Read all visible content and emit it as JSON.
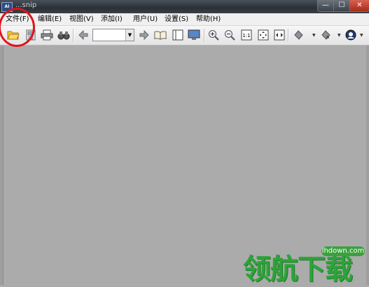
{
  "window": {
    "title": "...snip",
    "app_icon_text": "AI",
    "minimize": "—",
    "maximize": "☐",
    "close": "✕"
  },
  "menu": {
    "items": [
      "文件(F)",
      "编辑(E)",
      "视图(V)",
      "添加(I)",
      "用户(U)",
      "设置(S)",
      "帮助(H)"
    ]
  },
  "toolbar": {
    "buttons": [
      "open-folder-icon",
      "save-icon",
      "print-icon",
      "find-icon",
      "back-arrow-icon",
      "forward-arrow-icon",
      "open-book-icon",
      "single-page-icon",
      "monitor-icon",
      "zoom-in-icon",
      "zoom-out-icon",
      "actual-size-icon",
      "fit-page-icon",
      "fit-width-icon",
      "rotate-left-icon",
      "rotate-right-icon",
      "user-icon"
    ],
    "page_value": "",
    "dropdown_arrow": "▼"
  },
  "watermark": {
    "url": "lhdown.com",
    "logo": "领航下载"
  },
  "colors": {
    "annotation": "#e0131a",
    "workspace": "#ababab",
    "watermark": "#2ea33a"
  }
}
